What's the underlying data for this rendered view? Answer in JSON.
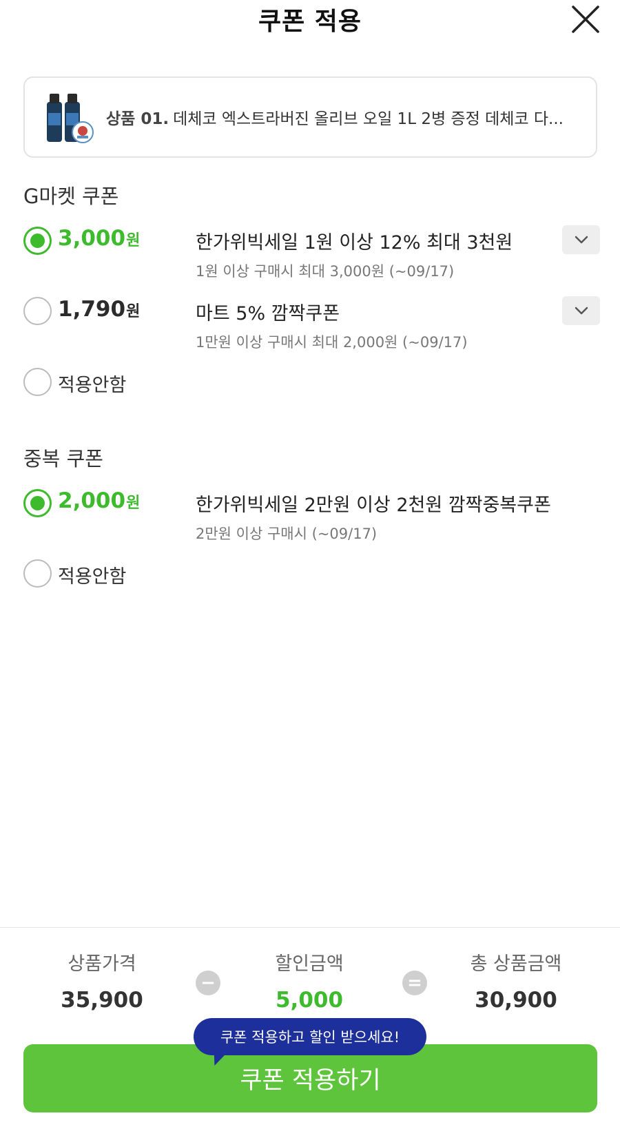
{
  "header": {
    "title": "쿠폰 적용"
  },
  "product": {
    "number": "상품 01.",
    "name": "데체코 엑스트라버진 올리브 오일 1L 2병 증정 데체코 다..."
  },
  "gmarket_section": {
    "title": "G마켓 쿠폰",
    "coupons": [
      {
        "amount": "3,000",
        "unit": "원",
        "name": "한가위빅세일 1원 이상 12% 최대 3천원",
        "desc": "1원 이상 구매시 최대 3,000원 (~09/17)",
        "selected": true
      },
      {
        "amount": "1,790",
        "unit": "원",
        "name": "마트 5% 깜짝쿠폰",
        "desc": "1만원 이상 구매시 최대 2,000원 (~09/17)",
        "selected": false
      }
    ],
    "none_label": "적용안함"
  },
  "dup_section": {
    "title": "중복 쿠폰",
    "coupons": [
      {
        "amount": "2,000",
        "unit": "원",
        "name": "한가위빅세일 2만원 이상 2천원 깜짝중복쿠폰",
        "desc": "2만원 이상 구매시 (~09/17)",
        "selected": true
      }
    ],
    "none_label": "적용안함"
  },
  "summary": {
    "price_label": "상품가격",
    "price_value": "35,900",
    "discount_label": "할인금액",
    "discount_value": "5,000",
    "total_label": "총 상품금액",
    "total_value": "30,900",
    "minus_symbol": "−",
    "equals_symbol": "="
  },
  "tooltip": "쿠폰 적용하고 할인 받으세요!",
  "apply_button": "쿠폰 적용하기",
  "colors": {
    "accent_green": "#3dbb2d",
    "button_green": "#5ec43c",
    "tooltip_navy": "#1d2f9a"
  }
}
